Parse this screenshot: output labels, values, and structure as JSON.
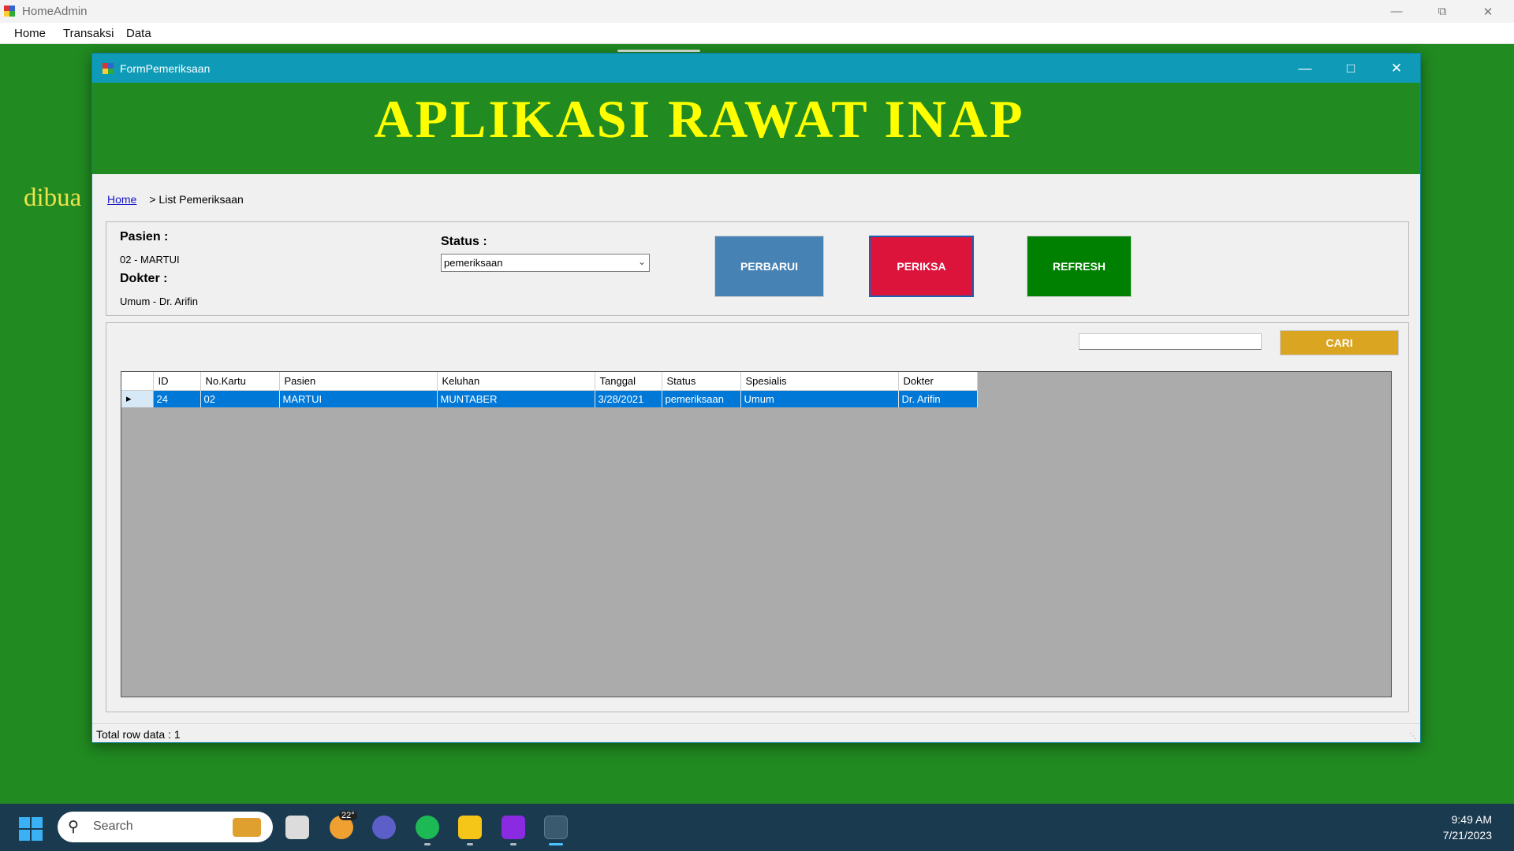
{
  "outer": {
    "title": "HomeAdmin",
    "menu": [
      "Home",
      "Transaksi",
      "Data"
    ],
    "background_text": "dibua"
  },
  "form": {
    "title": "FormPemeriksaan",
    "banner_title": "APLIKASI RAWAT INAP",
    "breadcrumb": {
      "home": "Home",
      "current": "> List Pemeriksaan"
    },
    "pasien_label": "Pasien :",
    "pasien_value": "02 - MARTUI",
    "dokter_label": "Dokter :",
    "dokter_value": "Umum - Dr. Arifin",
    "status_label": "Status :",
    "status_value": "pemeriksaan",
    "buttons": {
      "perbarui": "PERBARUI",
      "periksa": "PERIKSA",
      "refresh": "REFRESH",
      "cari": "CARI"
    },
    "search_value": "",
    "grid": {
      "columns": [
        "ID",
        "No.Kartu",
        "Pasien",
        "Keluhan",
        "Tanggal",
        "Status",
        "Spesialis",
        "Dokter"
      ],
      "rows": [
        [
          "24",
          "02",
          "MARTUI",
          "MUNTABER",
          "3/28/2021",
          "pemeriksaan",
          "Umum",
          "Dr. Arifin"
        ]
      ]
    },
    "status_bar": "Total row data : 1"
  },
  "taskbar": {
    "search_placeholder": "Search",
    "weather_badge": "22°",
    "time": "9:49 AM",
    "date": "7/21/2023"
  },
  "colors": {
    "background_green": "#218b21",
    "banner_yellow": "#ffff00",
    "titlebar_teal": "#0f9bb8",
    "perbarui": "#4682b4",
    "periksa": "#dc143c",
    "refresh": "#008000",
    "cari": "#daa520",
    "selection": "#0078d7"
  }
}
